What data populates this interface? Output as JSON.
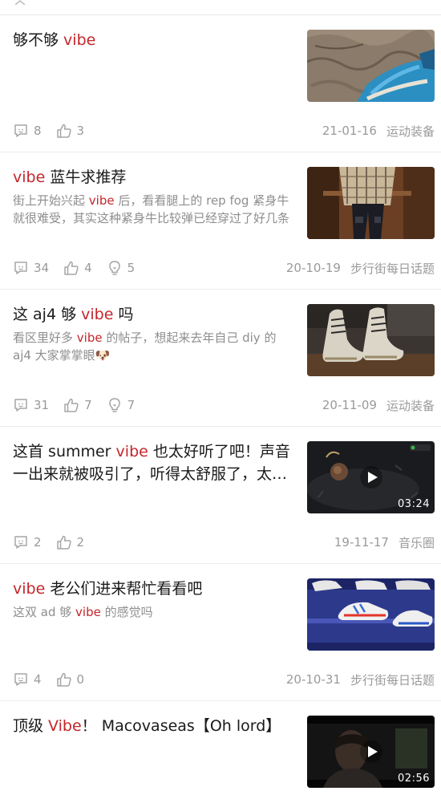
{
  "posts": [
    {
      "title_parts": [
        "够不够 ",
        "vibe",
        ""
      ],
      "excerpt_parts": null,
      "comments": "8",
      "likes": "3",
      "views": null,
      "date": "21-01-16",
      "category": "运动装备",
      "duration": null
    },
    {
      "title_parts": [
        "",
        "vibe",
        " 蓝牛求推荐"
      ],
      "excerpt_parts": [
        "街上开始兴起 ",
        "vibe",
        " 后，看看腿上的 rep fog 紧身牛就很难受，其实这种紧身牛比较弹已经穿过了好几条"
      ],
      "comments": "34",
      "likes": "4",
      "views": "5",
      "date": "20-10-19",
      "category": "步行街每日话题",
      "duration": null
    },
    {
      "title_parts": [
        "这 aj4 够 ",
        "vibe",
        " 吗"
      ],
      "excerpt_parts": [
        "看区里好多 ",
        "vibe",
        " 的帖子，想起来去年自己 diy 的aj4 大家掌掌眼🐶"
      ],
      "comments": "31",
      "likes": "7",
      "views": "7",
      "date": "20-11-09",
      "category": "运动装备",
      "duration": null
    },
    {
      "title_parts": [
        "这首 summer ",
        "vibe",
        " 也太好听了吧！声音一出来就被吸引了，听得太舒服了，太上头了"
      ],
      "excerpt_parts": null,
      "comments": "2",
      "likes": "2",
      "views": null,
      "date": "19-11-17",
      "category": "音乐圈",
      "duration": "03:24"
    },
    {
      "title_parts": [
        "",
        "vibe",
        " 老公们进来帮忙看看吧"
      ],
      "excerpt_parts": [
        "这双 ad 够 ",
        "vibe",
        " 的感觉吗"
      ],
      "comments": "4",
      "likes": "0",
      "views": null,
      "date": "20-10-31",
      "category": "步行街每日话题",
      "duration": null
    },
    {
      "title_parts": [
        "顶级 ",
        "Vibe",
        "！ Macovaseas【Oh lord】"
      ],
      "excerpt_parts": null,
      "comments": null,
      "likes": null,
      "views": null,
      "date": null,
      "category": null,
      "duration": "02:56"
    }
  ],
  "icons": {
    "comment": "comment-icon",
    "like": "thumbs-up-icon",
    "view": "lightbulb-icon",
    "play": "play-icon"
  },
  "colors": {
    "highlight": "#c4262c",
    "muted": "#9a9a9a"
  }
}
